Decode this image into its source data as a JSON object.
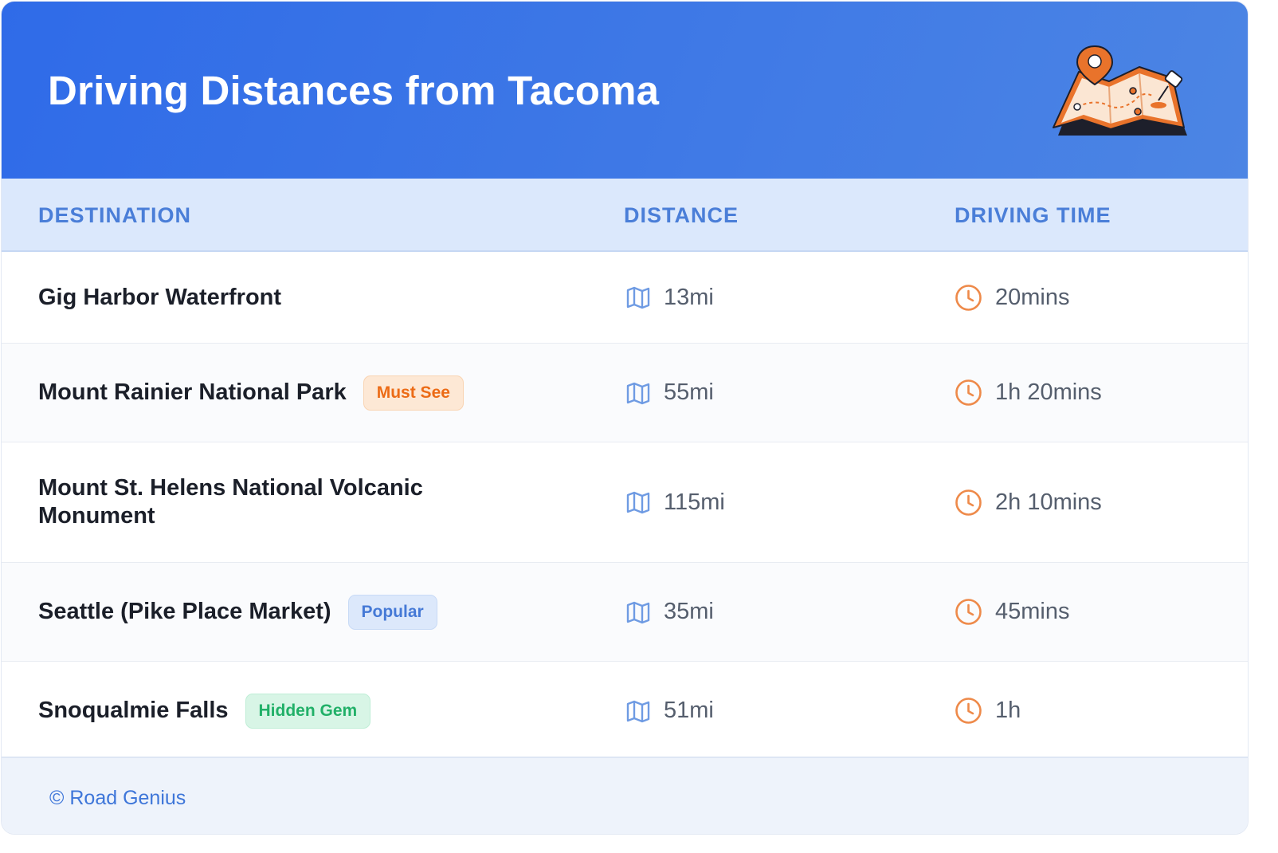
{
  "header": {
    "title": "Driving Distances from Tacoma",
    "illustration_icon": "folded-map-with-pins-icon"
  },
  "table": {
    "columns": [
      "DESTINATION",
      "DISTANCE",
      "DRIVING TIME"
    ],
    "distance_icon": "map-icon",
    "time_icon": "clock-icon",
    "rows": [
      {
        "destination": "Gig Harbor Waterfront",
        "badge": "",
        "badge_color": "",
        "distance": "13mi",
        "time": "20mins"
      },
      {
        "destination": "Mount Rainier National Park",
        "badge": "Must See",
        "badge_color": "#ec6b16",
        "distance": "55mi",
        "time": "1h 20mins"
      },
      {
        "destination": "Mount St. Helens National Volcanic Monument",
        "badge": "",
        "badge_color": "",
        "distance": "115mi",
        "time": "2h 10mins"
      },
      {
        "destination": "Seattle (Pike Place Market)",
        "badge": "Popular",
        "badge_color": "#4579d6",
        "distance": "35mi",
        "time": "45mins"
      },
      {
        "destination": "Snoqualmie Falls",
        "badge": "Hidden Gem",
        "badge_color": "#21b068",
        "distance": "51mi",
        "time": "1h"
      }
    ]
  },
  "footer": {
    "credit": "© Road Genius"
  },
  "colors": {
    "header_start": "#2f6be8",
    "header_end": "#4c85e4",
    "column_header_text": "#4a7ed8",
    "column_header_bg": "#dbe8fc",
    "map_icon": "#6f9be3",
    "clock_icon": "#ee8a4a",
    "footer_text": "#3e76d9"
  }
}
